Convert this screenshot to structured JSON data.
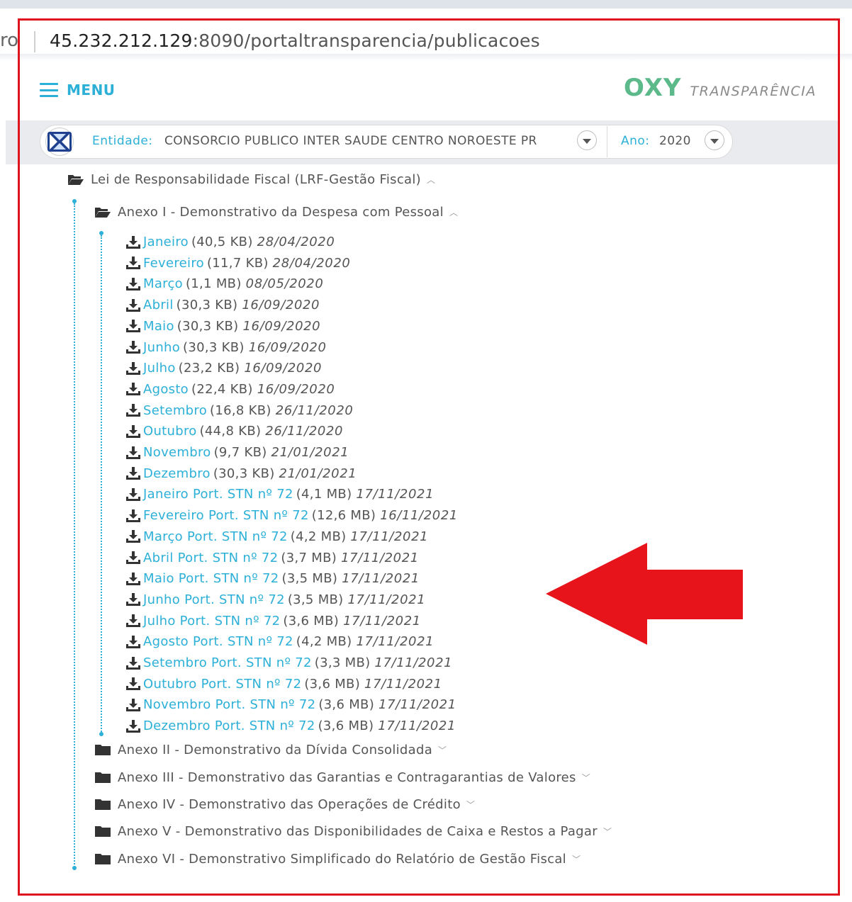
{
  "browser": {
    "url_prev": "ro",
    "url_host": "45.232.212.129",
    "url_rest": ":8090/portaltransparencia/publicacoes"
  },
  "header": {
    "menu_label": "MENU",
    "brand_logo": "OXY",
    "brand_text": "TRANSPARÊNCIA"
  },
  "filters": {
    "entity_label": "Entidade:",
    "entity_value": "CONSORCIO PUBLICO INTER SAUDE CENTRO NOROESTE PR",
    "year_label": "Ano:",
    "year_value": "2020"
  },
  "tree": {
    "root": "Lei de Responsabilidade Fiscal (LRF-Gestão Fiscal)",
    "anexo1": "Anexo I - Demonstrativo da Despesa com Pessoal",
    "files": [
      {
        "name": "Janeiro",
        "size": "(40,5 KB)",
        "date": "28/04/2020"
      },
      {
        "name": "Fevereiro",
        "size": "(11,7 KB)",
        "date": "28/04/2020"
      },
      {
        "name": "Março",
        "size": "(1,1 MB)",
        "date": "08/05/2020"
      },
      {
        "name": "Abril",
        "size": "(30,3 KB)",
        "date": "16/09/2020"
      },
      {
        "name": "Maio",
        "size": "(30,3 KB)",
        "date": "16/09/2020"
      },
      {
        "name": "Junho",
        "size": "(30,3 KB)",
        "date": "16/09/2020"
      },
      {
        "name": "Julho",
        "size": "(23,2 KB)",
        "date": "16/09/2020"
      },
      {
        "name": "Agosto",
        "size": "(22,4 KB)",
        "date": "16/09/2020"
      },
      {
        "name": "Setembro",
        "size": "(16,8 KB)",
        "date": "26/11/2020"
      },
      {
        "name": "Outubro",
        "size": "(44,8 KB)",
        "date": "26/11/2020"
      },
      {
        "name": "Novembro",
        "size": "(9,7 KB)",
        "date": "21/01/2021"
      },
      {
        "name": "Dezembro",
        "size": "(30,3 KB)",
        "date": "21/01/2021"
      },
      {
        "name": "Janeiro Port. STN nº 72",
        "size": "(4,1 MB)",
        "date": "17/11/2021"
      },
      {
        "name": "Fevereiro Port. STN nº 72",
        "size": "(12,6 MB)",
        "date": "16/11/2021"
      },
      {
        "name": "Março Port. STN nº 72",
        "size": "(4,2 MB)",
        "date": "17/11/2021"
      },
      {
        "name": "Abril Port. STN nº 72",
        "size": "(3,7 MB)",
        "date": "17/11/2021"
      },
      {
        "name": "Maio Port. STN nº 72",
        "size": "(3,5 MB)",
        "date": "17/11/2021"
      },
      {
        "name": "Junho Port. STN nº 72",
        "size": "(3,5 MB)",
        "date": "17/11/2021"
      },
      {
        "name": "Julho Port. STN nº 72",
        "size": "(3,6 MB)",
        "date": "17/11/2021"
      },
      {
        "name": "Agosto Port. STN nº 72",
        "size": "(4,2 MB)",
        "date": "17/11/2021"
      },
      {
        "name": "Setembro Port. STN nº 72",
        "size": "(3,3 MB)",
        "date": "17/11/2021"
      },
      {
        "name": "Outubro Port. STN nº 72",
        "size": "(3,6 MB)",
        "date": "17/11/2021"
      },
      {
        "name": "Novembro Port. STN nº 72",
        "size": "(3,6 MB)",
        "date": "17/11/2021"
      },
      {
        "name": "Dezembro Port. STN nº 72",
        "size": "(3,6 MB)",
        "date": "17/11/2021"
      }
    ],
    "collapsed": [
      "Anexo II - Demonstrativo da Dívida Consolidada",
      "Anexo III - Demonstrativo das Garantias e Contragarantias de Valores",
      "Anexo IV - Demonstrativo das Operações de Crédito",
      "Anexo V - Demonstrativo das Disponibilidades de Caixa e Restos a Pagar",
      "Anexo VI - Demonstrativo Simplificado do Relatório de Gestão Fiscal"
    ]
  },
  "colors": {
    "accent": "#2db0d8",
    "highlight_frame": "#e0141e",
    "arrow": "#e8141c",
    "brand_green": "#5bb98a"
  },
  "icons": {
    "menu": "hamburger-icon",
    "folder_open": "folder-open-icon",
    "folder_closed": "folder-icon",
    "download": "download-icon",
    "expanded": "chevron-up-icon",
    "collapsed": "chevron-down-icon"
  }
}
